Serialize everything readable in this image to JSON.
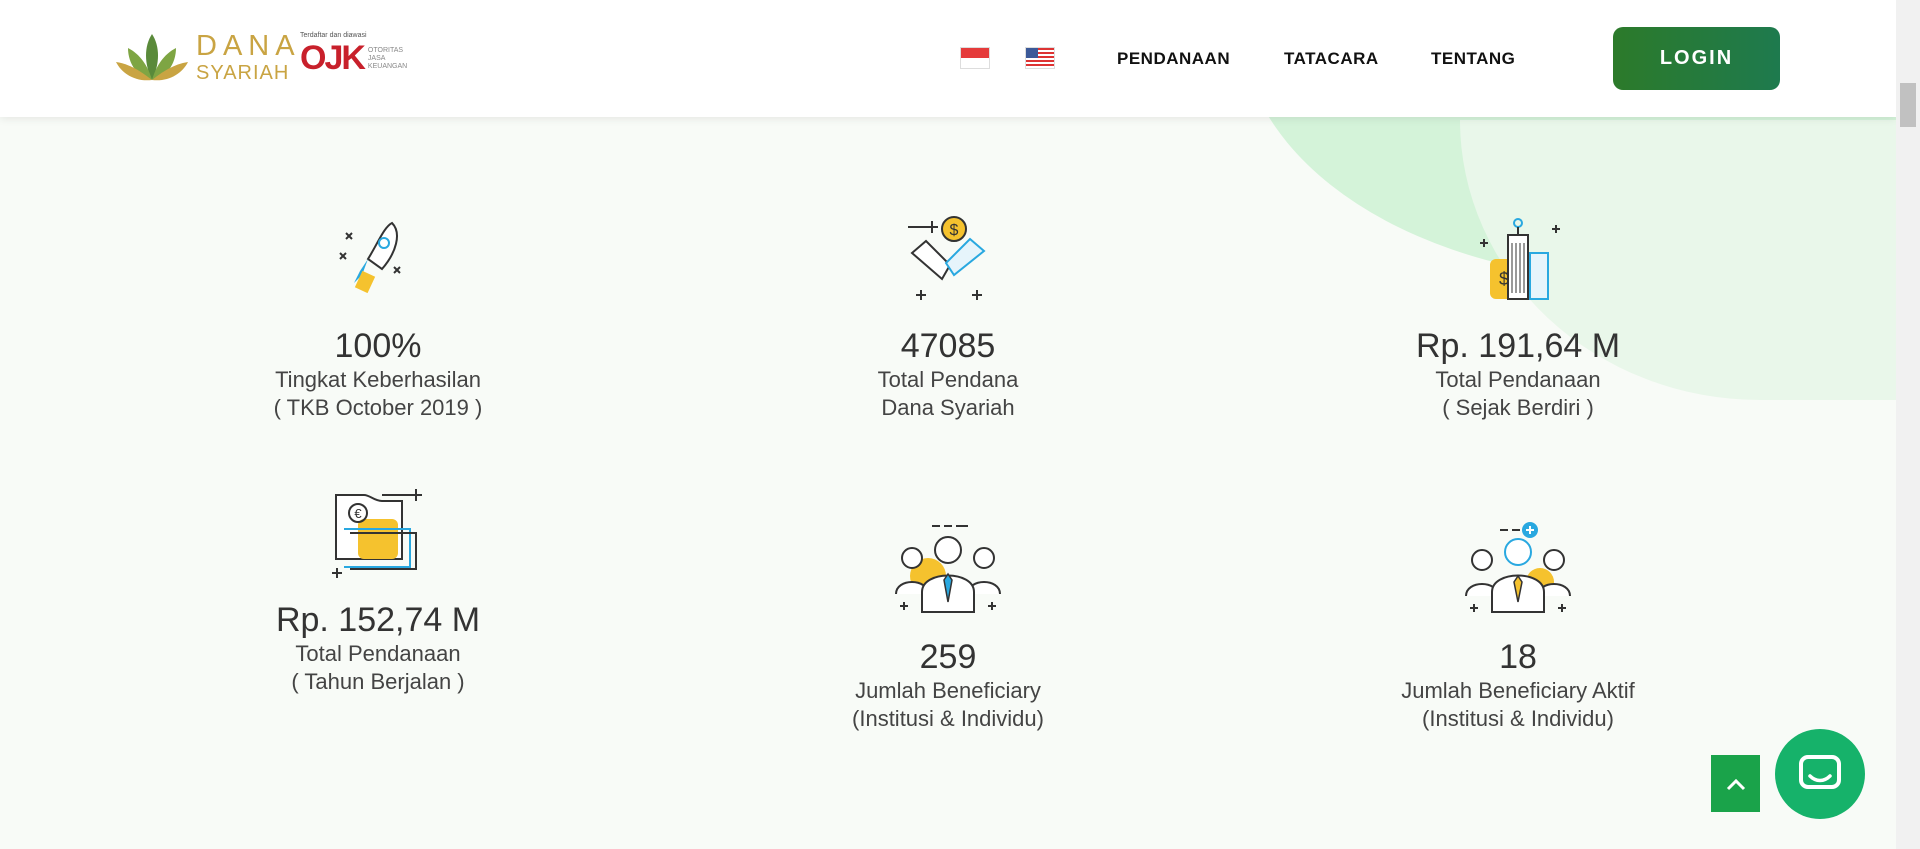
{
  "header": {
    "logo_line1": "DANA",
    "logo_line2": "SYARIAH",
    "ojk_registered": "Terdaftar dan diawasi",
    "ojk_letters": "OJK",
    "ojk_line1": "OTORITAS",
    "ojk_line2": "JASA",
    "ojk_line3": "KEUANGAN",
    "nav": [
      "PENDANAAN",
      "TATACARA",
      "TENTANG"
    ],
    "login_label": "LOGIN"
  },
  "stats": [
    {
      "value": "100%",
      "label1": "Tingkat Keberhasilan",
      "label2": "( TKB October 2019 )",
      "icon": "rocket-icon"
    },
    {
      "value": "47085",
      "label1": "Total Pendana",
      "label2": "Dana Syariah",
      "icon": "handshake-icon"
    },
    {
      "value": "Rp. 191,64 M",
      "label1": "Total Pendanaan",
      "label2": "( Sejak Berdiri )",
      "icon": "buildings-icon"
    },
    {
      "value": "Rp. 152,74 M",
      "label1": "Total Pendanaan",
      "label2": "( Tahun Berjalan )",
      "icon": "money-icon"
    },
    {
      "value": "259",
      "label1": "Jumlah Beneficiary",
      "label2": "(Institusi & Individu)",
      "icon": "group-icon"
    },
    {
      "value": "18",
      "label1": "Jumlah Beneficiary Aktif",
      "label2": "(Institusi & Individu)",
      "icon": "active-group-icon"
    }
  ],
  "colors": {
    "accent": "#1e7a3a",
    "gold": "#c9a443",
    "yellow": "#f5c22e",
    "blue": "#29a8e0"
  }
}
